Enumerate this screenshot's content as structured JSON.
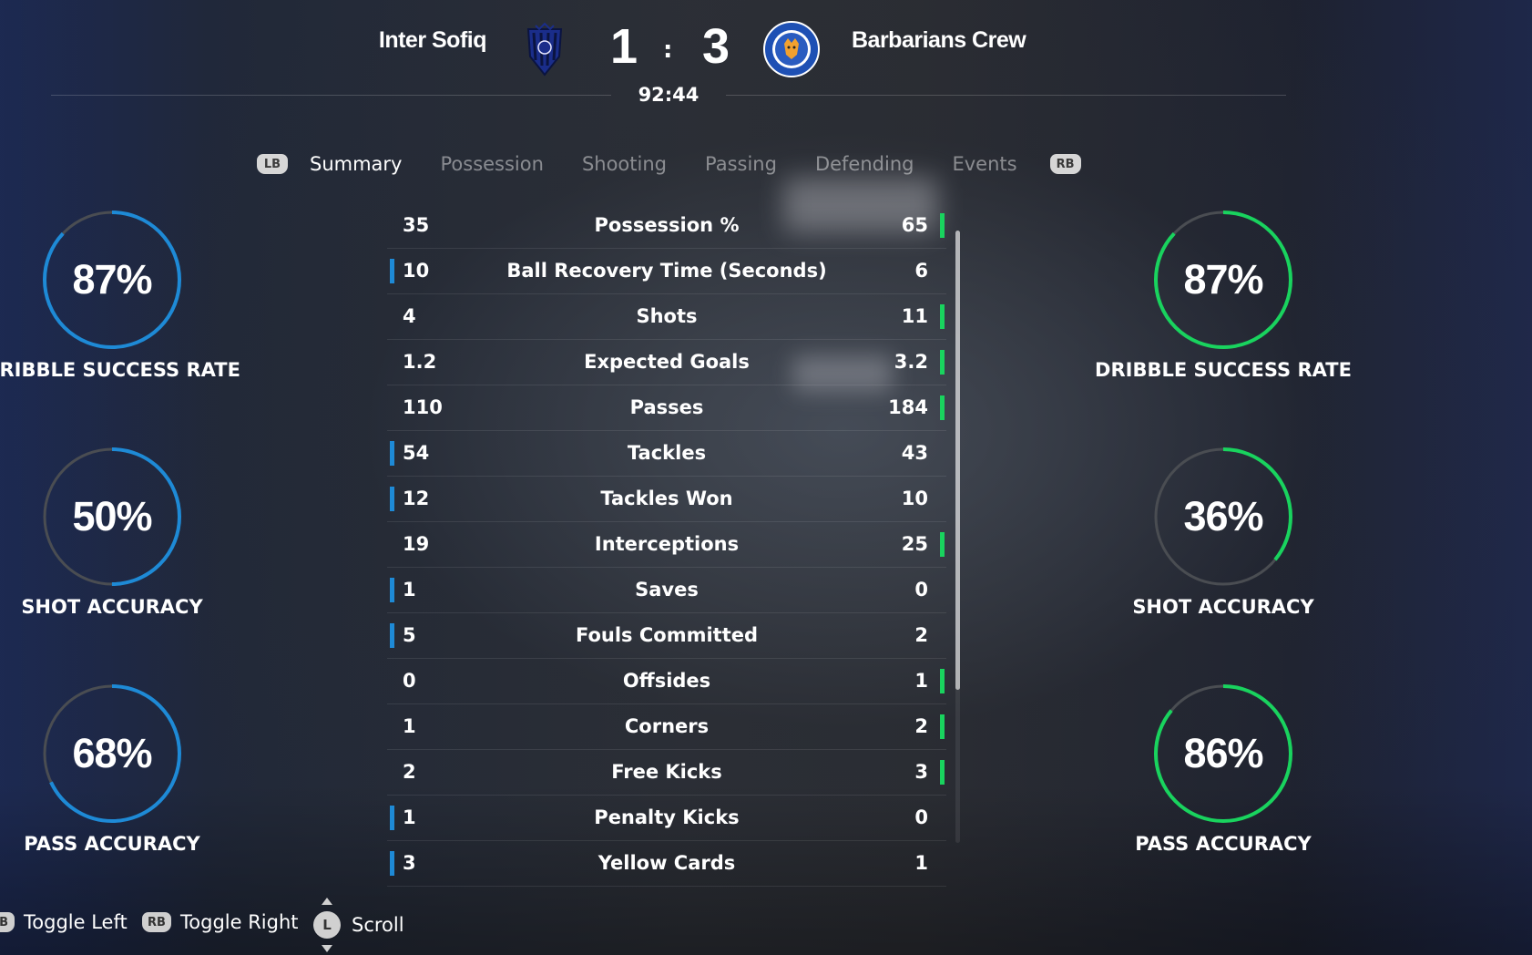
{
  "match": {
    "home_team": "Inter Sofiq",
    "away_team": "Barbarians Crew",
    "home_score": "1",
    "separator": ":",
    "away_score": "3",
    "clock": "92:44"
  },
  "tabs": {
    "lb": "LB",
    "rb": "RB",
    "items": [
      "Summary",
      "Possession",
      "Shooting",
      "Passing",
      "Defending",
      "Events"
    ],
    "active": "Summary"
  },
  "stats": [
    {
      "label": "Possession %",
      "home": "35",
      "away": "65",
      "leader": "away"
    },
    {
      "label": "Ball Recovery Time (Seconds)",
      "home": "10",
      "away": "6",
      "leader": "home"
    },
    {
      "label": "Shots",
      "home": "4",
      "away": "11",
      "leader": "away"
    },
    {
      "label": "Expected Goals",
      "home": "1.2",
      "away": "3.2",
      "leader": "away"
    },
    {
      "label": "Passes",
      "home": "110",
      "away": "184",
      "leader": "away"
    },
    {
      "label": "Tackles",
      "home": "54",
      "away": "43",
      "leader": "home"
    },
    {
      "label": "Tackles Won",
      "home": "12",
      "away": "10",
      "leader": "home"
    },
    {
      "label": "Interceptions",
      "home": "19",
      "away": "25",
      "leader": "away"
    },
    {
      "label": "Saves",
      "home": "1",
      "away": "0",
      "leader": "home"
    },
    {
      "label": "Fouls Committed",
      "home": "5",
      "away": "2",
      "leader": "home"
    },
    {
      "label": "Offsides",
      "home": "0",
      "away": "1",
      "leader": "away"
    },
    {
      "label": "Corners",
      "home": "1",
      "away": "2",
      "leader": "away"
    },
    {
      "label": "Free Kicks",
      "home": "2",
      "away": "3",
      "leader": "away"
    },
    {
      "label": "Penalty Kicks",
      "home": "1",
      "away": "0",
      "leader": "home"
    },
    {
      "label": "Yellow Cards",
      "home": "3",
      "away": "1",
      "leader": "home"
    }
  ],
  "gauges": {
    "home": [
      {
        "value": "87%",
        "fraction": 0.87,
        "label": "DRIBBLE SUCCESS RATE"
      },
      {
        "value": "50%",
        "fraction": 0.5,
        "label": "SHOT ACCURACY"
      },
      {
        "value": "68%",
        "fraction": 0.68,
        "label": "PASS ACCURACY"
      }
    ],
    "away": [
      {
        "value": "87%",
        "fraction": 0.87,
        "label": "DRIBBLE SUCCESS RATE"
      },
      {
        "value": "36%",
        "fraction": 0.36,
        "label": "SHOT ACCURACY"
      },
      {
        "value": "86%",
        "fraction": 0.86,
        "label": "PASS ACCURACY"
      }
    ]
  },
  "colors": {
    "home": "#1e8ad6",
    "away": "#19d35e",
    "track": "#4a4d52"
  },
  "footer": {
    "toggle_left_button": "LB",
    "toggle_left": "Toggle Left",
    "toggle_right_button": "RB",
    "toggle_right": "Toggle Right",
    "scroll_button": "L",
    "scroll": "Scroll"
  }
}
